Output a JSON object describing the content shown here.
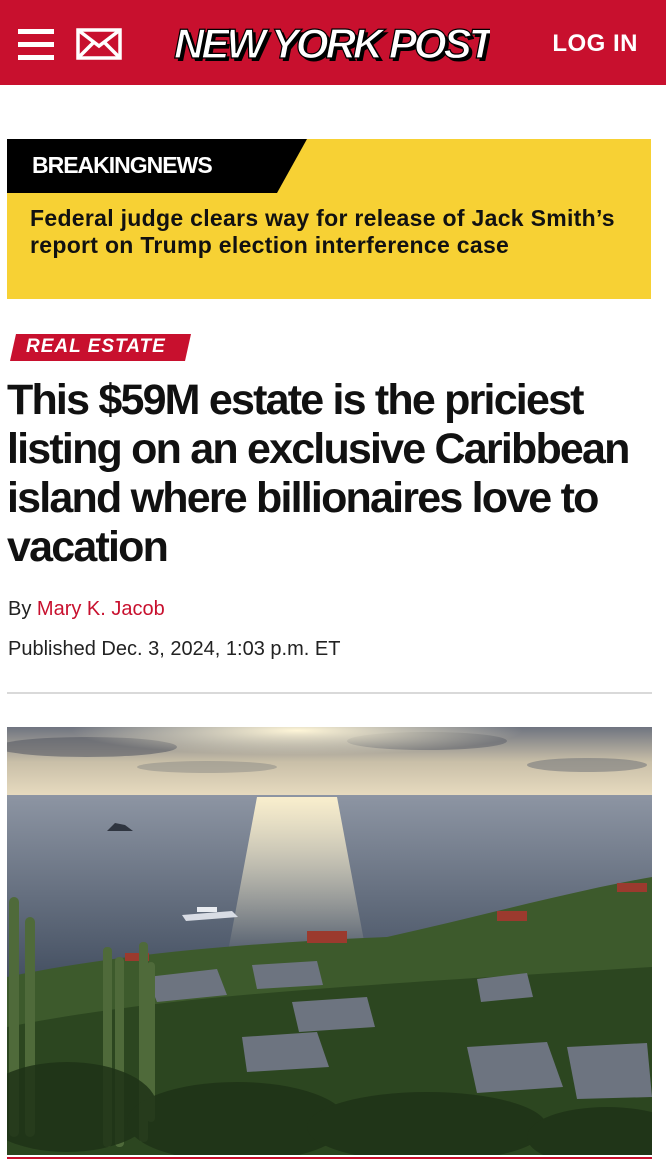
{
  "header": {
    "logo_text": "NEW YORK POST",
    "login_label": "LOG IN",
    "menu_icon": "hamburger-menu-icon",
    "mail_icon": "envelope-icon",
    "brand_color": "#c8102e"
  },
  "breaking": {
    "label": "BREAKINGNEWS",
    "text": "Federal judge clears way for release of Jack Smith’s report on Trump election interference case",
    "background_color": "#f7d134"
  },
  "article": {
    "category": "REAL ESTATE",
    "headline": "This $59M estate is the priciest listing on an exclusive Caribbean island where billionaires love to vacation",
    "byline_prefix": "By",
    "author": "Mary K. Jacob",
    "published": "Published Dec. 3, 2024, 1:03 p.m. ET"
  }
}
